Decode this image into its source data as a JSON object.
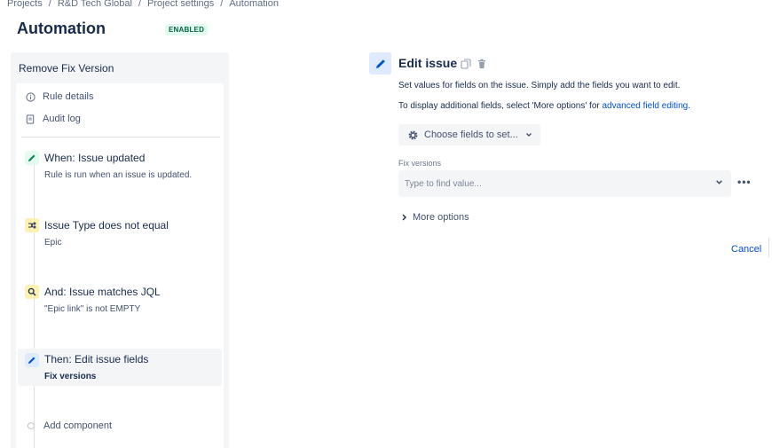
{
  "breadcrumb": {
    "items": [
      "Projects",
      "R&D Tech Global",
      "Project settings",
      "Automation"
    ],
    "separator": "/"
  },
  "page": {
    "title": "Automation",
    "status": "ENABLED"
  },
  "rule": {
    "name": "Remove Fix Version",
    "menu": {
      "details": "Rule details",
      "audit": "Audit log"
    },
    "steps": [
      {
        "type": "trigger",
        "icon": "pencil-icon",
        "title": "When: Issue updated",
        "subtitle": "Rule is run when an issue is updated."
      },
      {
        "type": "condition",
        "icon": "branch-icon",
        "title": "Issue Type does not equal",
        "subtitle": "Epic"
      },
      {
        "type": "condition",
        "icon": "search-icon",
        "title": "And: Issue matches JQL",
        "subtitle": "\"Epic link\" is not EMPTY"
      },
      {
        "type": "action",
        "icon": "pencil-icon",
        "title": "Then: Edit issue fields",
        "subtitle": "Fix versions"
      }
    ],
    "add_component": "Add component"
  },
  "editor": {
    "title": "Edit issue",
    "description1": "Set values for fields on the issue. Simply add the fields you want to edit.",
    "description2_prefix": "To display additional fields, select 'More options' for ",
    "description2_link": "advanced field editing",
    "description2_suffix": ".",
    "choose_fields_label": "Choose fields to set...",
    "field_label": "Fix versions",
    "field_placeholder": "Type to find value...",
    "more_options": "More options",
    "cancel": "Cancel"
  },
  "colors": {
    "primary_text": "#172b4d",
    "link": "#0052cc",
    "trigger": "#00875a",
    "action": "#0052cc",
    "enabled_bg": "#e3fcef",
    "enabled_text": "#006644"
  }
}
